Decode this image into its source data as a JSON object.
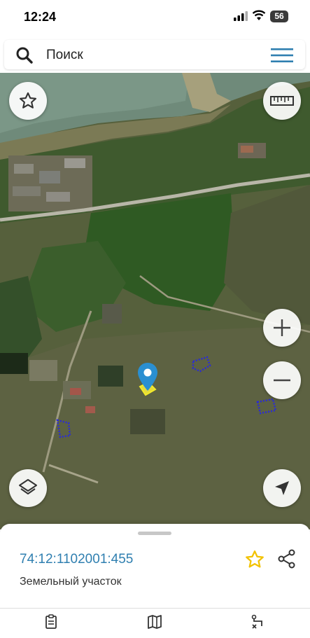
{
  "status_bar": {
    "time": "12:24",
    "battery": "56"
  },
  "search": {
    "placeholder": "Поиск"
  },
  "map": {
    "icons": [
      "star-icon",
      "ruler-icon",
      "zoom-in-icon",
      "zoom-out-icon",
      "layers-icon",
      "location-arrow-icon",
      "map-pin-icon"
    ]
  },
  "parcel": {
    "cadastral_number": "74:12:1102001:455",
    "type": "Земельный участок"
  },
  "bottom_nav": {
    "icons": [
      "document-icon",
      "map-icon",
      "route-icon"
    ]
  },
  "colors": {
    "accent": "#2f7fb0",
    "favorite": "#f2c200",
    "pin": "#2a8fd1"
  }
}
